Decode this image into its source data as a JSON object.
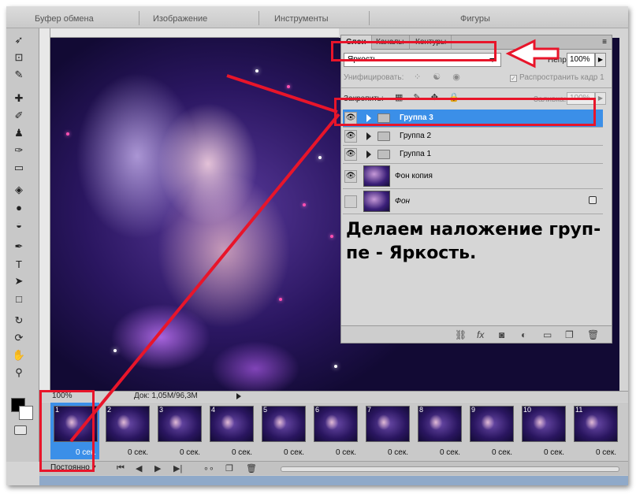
{
  "panel_headers": [
    "Буфер обмена",
    "Изображение",
    "Инструменты",
    "Фигуры"
  ],
  "layers_panel": {
    "tabs": [
      "Слои",
      "Каналы",
      "Контуры"
    ],
    "blend_mode": "Яркость",
    "opacity_label": "Непр",
    "opacity_value": "100%",
    "unify_label": "Унифицировать:",
    "propagate_label": "Распространить кадр 1",
    "lock_label": "Закрепить:",
    "fill_label": "Заливка:",
    "fill_value": "100%",
    "layers": [
      {
        "name": "Группа 3",
        "type": "group",
        "visible": true,
        "selected": true
      },
      {
        "name": "Группа 2",
        "type": "group",
        "visible": true,
        "selected": false
      },
      {
        "name": "Группа 1",
        "type": "group",
        "visible": true,
        "selected": false
      },
      {
        "name": "Фон копия",
        "type": "image",
        "visible": true,
        "selected": false
      },
      {
        "name": "Фон",
        "type": "image",
        "visible": false,
        "selected": false,
        "locked": true
      }
    ],
    "annotation_text": "Делаем наложение груп-пе - Яркость."
  },
  "status_bar": {
    "zoom": "100%",
    "doc_size": "Док: 1,05M/96,3M"
  },
  "timeline": {
    "frames": [
      {
        "number": "1",
        "duration": "0 сек."
      },
      {
        "number": "2",
        "duration": "0 сек."
      },
      {
        "number": "3",
        "duration": "0 сек."
      },
      {
        "number": "4",
        "duration": "0 сек."
      },
      {
        "number": "5",
        "duration": "0 сек."
      },
      {
        "number": "6",
        "duration": "0 сек."
      },
      {
        "number": "7",
        "duration": "0 сек."
      },
      {
        "number": "8",
        "duration": "0 сек."
      },
      {
        "number": "9",
        "duration": "0 сек."
      },
      {
        "number": "10",
        "duration": "0 сек."
      },
      {
        "number": "11",
        "duration": "0 сек."
      }
    ],
    "loop_option": "Постоянно"
  },
  "colors": {
    "selection": "#3b8fe8",
    "annotation_red": "#e8152a",
    "panel_bg": "#d6d6d6"
  },
  "icons": [
    "eye-icon",
    "folder-icon",
    "lock-icon",
    "link-icon",
    "fx-icon",
    "mask-icon",
    "adjustment-icon",
    "new-group-icon",
    "new-layer-icon",
    "trash-icon",
    "play-icon",
    "tween-icon"
  ]
}
